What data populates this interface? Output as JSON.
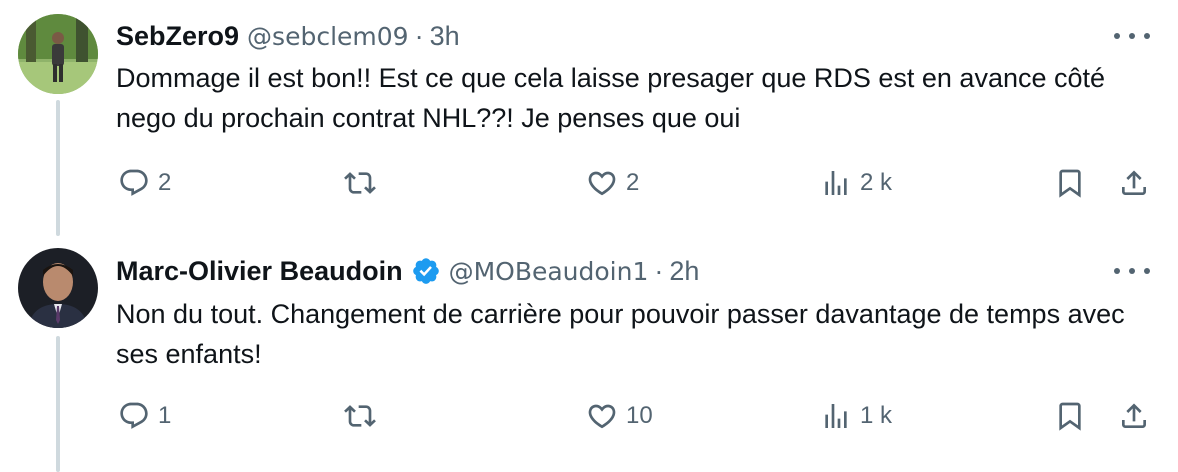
{
  "tweets": [
    {
      "display_name": "SebZero9",
      "handle": "@sebclem09",
      "separator": "·",
      "time": "3h",
      "verified": false,
      "text": "Dommage il est bon!! Est ce que cela laisse presager que RDS est en avance côté nego du prochain contrat NHL??! Je penses que oui",
      "replies": "2",
      "reposts": "",
      "likes": "2",
      "views": "2 k"
    },
    {
      "display_name": "Marc-Olivier Beaudoin",
      "handle": "@MOBeaudoin1",
      "separator": "·",
      "time": "2h",
      "verified": true,
      "text": "Non du tout. Changement de carrière pour pouvoir passer davantage de temps avec ses enfants!",
      "replies": "1",
      "reposts": "",
      "likes": "10",
      "views": "1 k"
    }
  ],
  "colors": {
    "text": "#0f1419",
    "muted": "#536471",
    "thread_line": "#cfd9de",
    "verified_blue": "#1d9bf0"
  },
  "icons": [
    "reply-icon",
    "repost-icon",
    "like-icon",
    "views-icon",
    "bookmark-icon",
    "share-icon",
    "more-icon",
    "verified-badge-icon"
  ]
}
